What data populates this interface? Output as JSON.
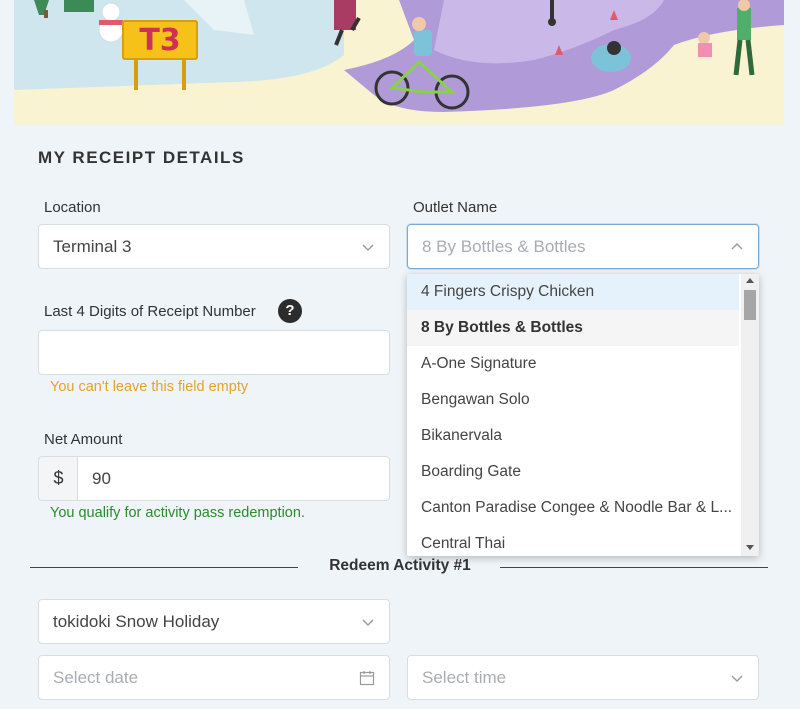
{
  "banner": {
    "sign_text": "T3"
  },
  "section": {
    "title": "MY RECEIPT DETAILS"
  },
  "location": {
    "label": "Location",
    "value": "Terminal 3"
  },
  "outlet": {
    "label": "Outlet Name",
    "value": "8 By Bottles & Bottles",
    "options": [
      "4 Fingers Crispy Chicken",
      "8 By Bottles & Bottles",
      "A-One Signature",
      "Bengawan Solo",
      "Bikanervala",
      "Boarding Gate",
      "Canton Paradise Congee & Noodle Bar & L...",
      "Central Thai"
    ]
  },
  "receipt": {
    "label": "Last 4 Digits of Receipt Number",
    "help": "?",
    "value": "",
    "error": "You can't leave this field empty"
  },
  "amount": {
    "label": "Net Amount",
    "currency": "$",
    "value": "90",
    "message": "You qualify for activity pass redemption."
  },
  "redeem": {
    "heading": "Redeem Activity #1",
    "activity_value": "tokidoki Snow Holiday",
    "date_placeholder": "Select date",
    "time_placeholder": "Select time"
  },
  "icons": {
    "chevron": "chevron-down-icon",
    "calendar": "calendar-icon",
    "help": "question-icon"
  },
  "colors": {
    "error": "#e1a52a",
    "success": "#2e8a2e",
    "focus_border": "#7ea9d2",
    "banner_bg": "#faf3d2"
  }
}
